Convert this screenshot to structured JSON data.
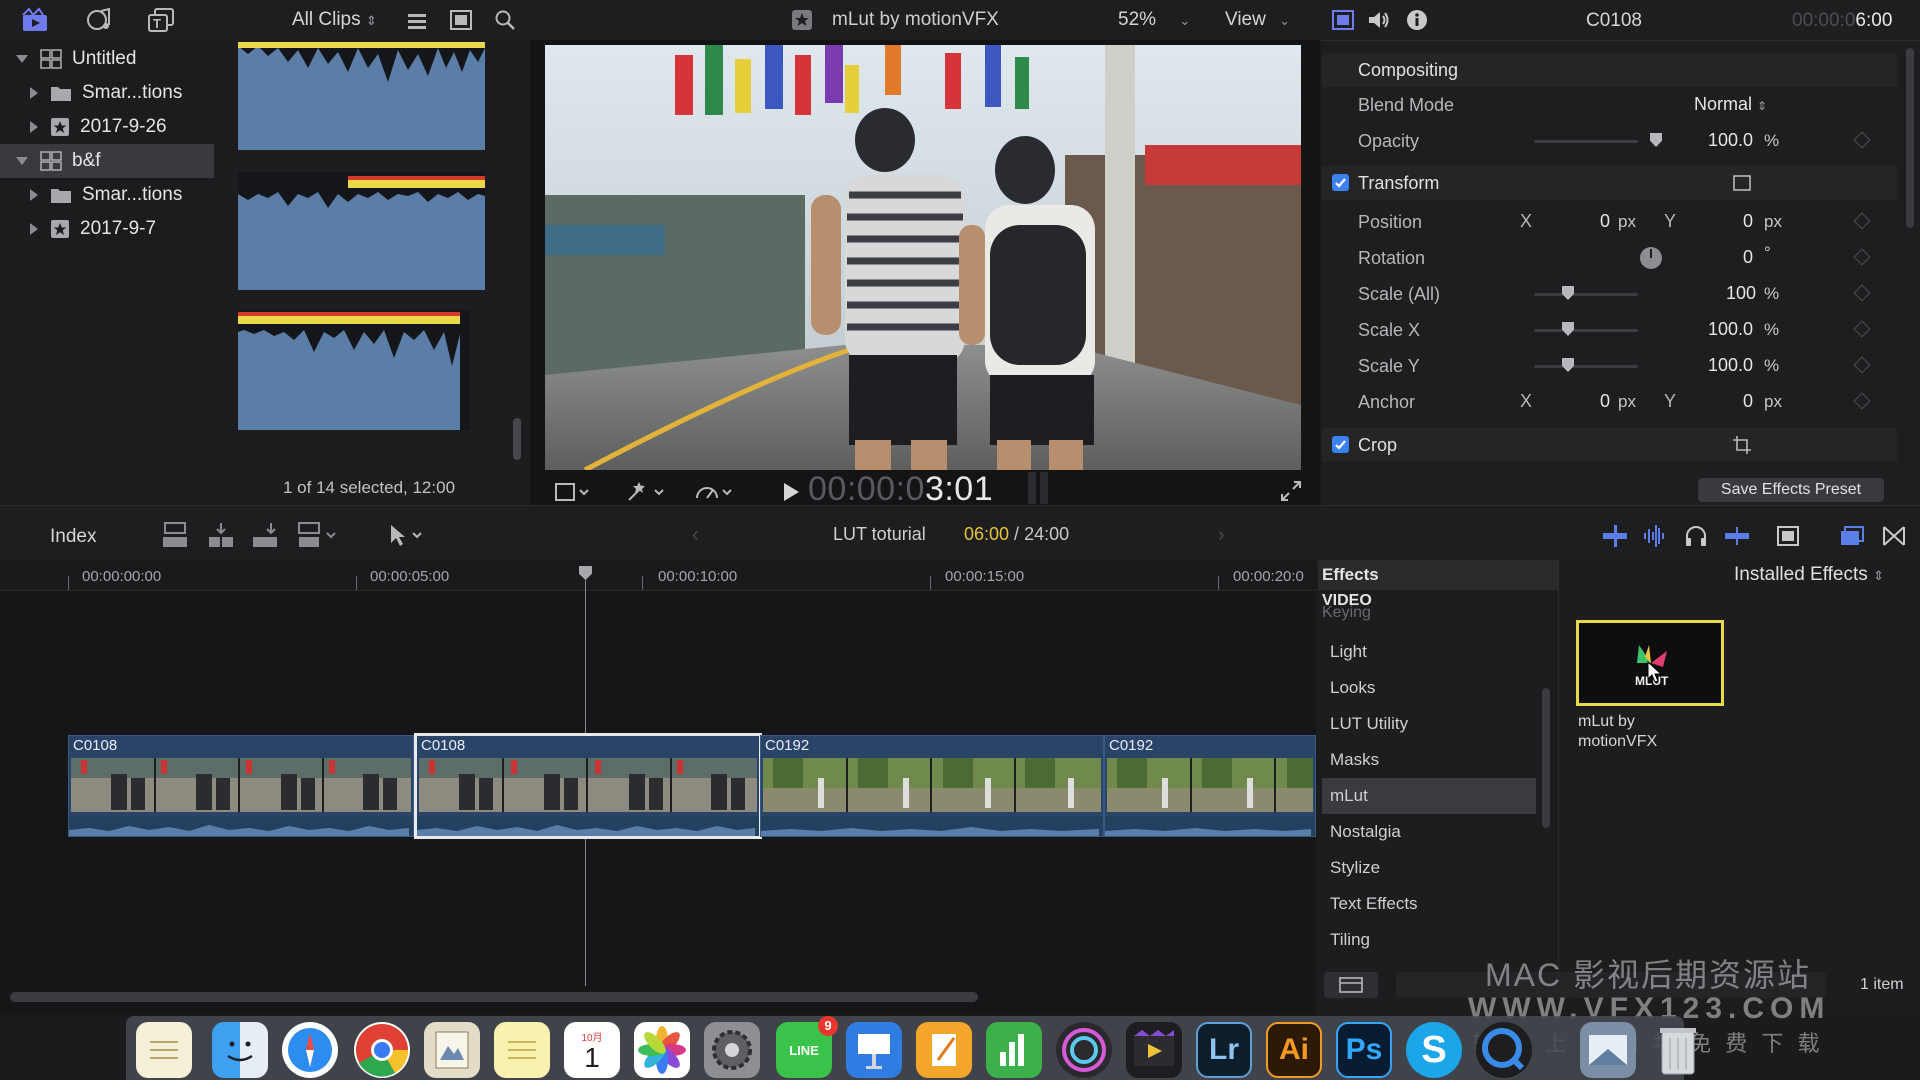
{
  "top_toolbar": {
    "clips_filter": "All Clips",
    "viewer_title": "mLut by motionVFX",
    "zoom": "52%",
    "view_menu": "View"
  },
  "inspector_header": {
    "clip_name": "C0108",
    "duration_prefix": "00:00:0",
    "duration_main": "6:00"
  },
  "library": {
    "items": [
      {
        "label": "Untitled",
        "kind": "library"
      },
      {
        "label": "Smar...tions",
        "kind": "folder"
      },
      {
        "label": "2017-9-26",
        "kind": "event"
      },
      {
        "label": "b&f",
        "kind": "library"
      },
      {
        "label": "Smar...tions",
        "kind": "folder"
      },
      {
        "label": "2017-9-7",
        "kind": "event"
      }
    ]
  },
  "browser": {
    "status": "1 of 14 selected, 12:00"
  },
  "viewer": {
    "timecode_dim": "00:00:0",
    "timecode_main": "3:01"
  },
  "inspector": {
    "compositing_title": "Compositing",
    "blend_mode_label": "Blend Mode",
    "blend_mode_value": "Normal",
    "opacity_label": "Opacity",
    "opacity_value": "100.0",
    "opacity_unit": "%",
    "transform_title": "Transform",
    "position_label": "Position",
    "position_x_axis": "X",
    "position_x": "0",
    "position_x_unit": "px",
    "position_y_axis": "Y",
    "position_y": "0",
    "position_y_unit": "px",
    "rotation_label": "Rotation",
    "rotation_value": "0",
    "rotation_unit": "°",
    "scale_all_label": "Scale (All)",
    "scale_all_value": "100",
    "scale_all_unit": "%",
    "scale_x_label": "Scale X",
    "scale_x_value": "100.0",
    "scale_x_unit": "%",
    "scale_y_label": "Scale Y",
    "scale_y_value": "100.0",
    "scale_y_unit": "%",
    "anchor_label": "Anchor",
    "anchor_x_axis": "X",
    "anchor_x": "0",
    "anchor_x_unit": "px",
    "anchor_y_axis": "Y",
    "anchor_y": "0",
    "anchor_y_unit": "px",
    "crop_title": "Crop",
    "save_preset": "Save Effects Preset"
  },
  "timeline_toolbar": {
    "index_label": "Index",
    "project_name": "LUT toturial",
    "position": "06:00",
    "separator": " / ",
    "total": "24:00"
  },
  "ruler": {
    "ticks": [
      "00:00:00:00",
      "00:00:05:00",
      "00:00:10:00",
      "00:00:15:00",
      "00:00:20:0"
    ]
  },
  "clips": [
    {
      "name": "C0108"
    },
    {
      "name": "C0108"
    },
    {
      "name": "C0192"
    },
    {
      "name": "C0192"
    }
  ],
  "effects": {
    "header": "Effects",
    "installed_label": "Installed Effects",
    "category_header": "VIDEO",
    "peek_item": "Keying",
    "categories": [
      "Light",
      "Looks",
      "LUT Utility",
      "Masks",
      "mLut",
      "Nostalgia",
      "Stylize",
      "Text Effects",
      "Tiling"
    ],
    "selected_category": "mLut",
    "tile_label": "mLut by motionVFX",
    "tile_caption_1": "mLut by",
    "tile_caption_2": "motionVFX",
    "tile_mark": "MLUT",
    "item_count": "1 item"
  },
  "watermark": {
    "line1": "MAC 影视后期资源站",
    "line2": "WWW.VFX123.COM",
    "line3": "输 入 上 方 网 址 免 费 下 载"
  },
  "dock": {
    "calendar_month": "10月",
    "calendar_day": "1",
    "line_badge": "9",
    "line_label": "LINE",
    "lr_label": "Lr",
    "ai_label": "Ai",
    "ps_label": "Ps"
  },
  "colors": {
    "accent_blue": "#3b82f0",
    "clip_blue": "#2a4468",
    "selection_yellow": "#e8d84a",
    "waveform_blue": "#5b7ea8"
  }
}
